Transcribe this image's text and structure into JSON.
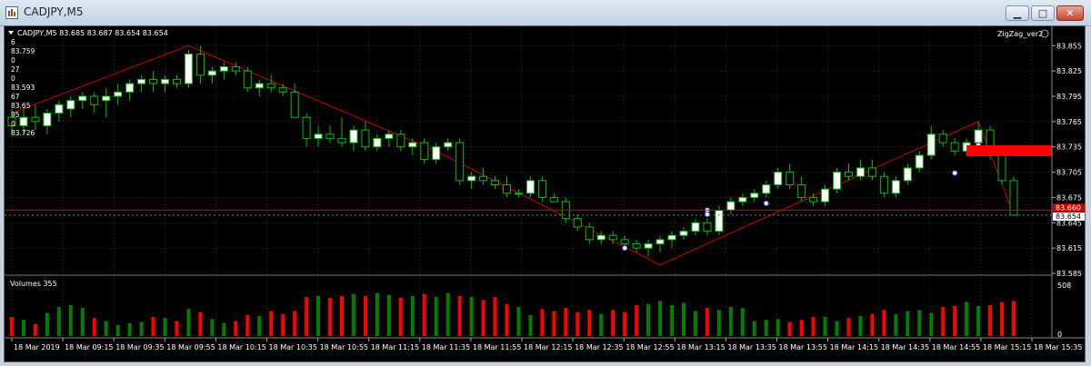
{
  "window": {
    "title": "CADJPY,M5",
    "minimize_glyph": "▁",
    "maximize_glyph": "□",
    "close_glyph": "✕"
  },
  "chart": {
    "header": "CADJPY,M5  83.685 83.687 83.654 83.654",
    "indicator_label": "ZigZag_ver2",
    "indicator_icon": "settings-circle-icon",
    "left_panel_values": [
      "6",
      "83.759",
      "0",
      "27",
      "0",
      "83.593",
      "67",
      "83.65",
      "95",
      "0",
      "83.726"
    ],
    "price_axis": [
      "83.855",
      "83.825",
      "83.795",
      "83.765",
      "83.735",
      "83.705",
      "83.675",
      "83.645",
      "83.615",
      "83.585"
    ],
    "current_price": "83.654",
    "red_line_label": "83.660",
    "volume_label": "Volumes 355",
    "volume_axis": [
      "508",
      "0"
    ],
    "time_axis": [
      "18 Mar 2019",
      "18 Mar 09:15",
      "18 Mar 09:35",
      "18 Mar 09:55",
      "18 Mar 10:15",
      "18 Mar 10:35",
      "18 Mar 10:55",
      "18 Mar 11:15",
      "18 Mar 11:35",
      "18 Mar 11:55",
      "18 Mar 12:15",
      "18 Mar 12:35",
      "18 Mar 12:55",
      "18 Mar 13:15",
      "18 Mar 13:35",
      "18 Mar 13:55",
      "18 Mar 14:15",
      "18 Mar 14:35",
      "18 Mar 14:55",
      "18 Mar 15:15",
      "18 Mar 15:35"
    ],
    "colors": {
      "background": "#000000",
      "grid": "#4a4a4a",
      "bull_body": "#ffffff",
      "bear_body": "#000000",
      "wick": "#00c000",
      "zigzag": "#cc0000",
      "vol_up": "#008000",
      "vol_down": "#ff0000"
    }
  },
  "chart_data": {
    "type": "candlestick",
    "symbol": "CADJPY",
    "timeframe": "M5",
    "ylim": [
      83.585,
      83.865
    ],
    "candles": [
      [
        83.77,
        83.78,
        83.75,
        83.76
      ],
      [
        83.76,
        83.78,
        83.75,
        83.77
      ],
      [
        83.77,
        83.785,
        83.755,
        83.765
      ],
      [
        83.76,
        83.78,
        83.75,
        83.775
      ],
      [
        83.775,
        83.79,
        83.765,
        83.785
      ],
      [
        83.78,
        83.795,
        83.77,
        83.79
      ],
      [
        83.79,
        83.8,
        83.78,
        83.795
      ],
      [
        83.795,
        83.8,
        83.775,
        83.785
      ],
      [
        83.79,
        83.805,
        83.77,
        83.795
      ],
      [
        83.795,
        83.81,
        83.785,
        83.8
      ],
      [
        83.8,
        83.815,
        83.79,
        83.81
      ],
      [
        83.81,
        83.82,
        83.8,
        83.815
      ],
      [
        83.815,
        83.825,
        83.8,
        83.81
      ],
      [
        83.81,
        83.82,
        83.8,
        83.815
      ],
      [
        83.815,
        83.82,
        83.805,
        83.81
      ],
      [
        83.81,
        83.85,
        83.805,
        83.845
      ],
      [
        83.845,
        83.855,
        83.81,
        83.82
      ],
      [
        83.82,
        83.83,
        83.81,
        83.825
      ],
      [
        83.825,
        83.835,
        83.815,
        83.83
      ],
      [
        83.83,
        83.835,
        83.82,
        83.825
      ],
      [
        83.825,
        83.83,
        83.8,
        83.805
      ],
      [
        83.805,
        83.815,
        83.795,
        83.81
      ],
      [
        83.81,
        83.82,
        83.8,
        83.805
      ],
      [
        83.805,
        83.81,
        83.795,
        83.8
      ],
      [
        83.8,
        83.81,
        83.79,
        83.77
      ],
      [
        83.77,
        83.775,
        83.735,
        83.745
      ],
      [
        83.745,
        83.76,
        83.735,
        83.75
      ],
      [
        83.75,
        83.76,
        83.74,
        83.745
      ],
      [
        83.745,
        83.77,
        83.735,
        83.74
      ],
      [
        83.74,
        83.76,
        83.73,
        83.755
      ],
      [
        83.755,
        83.765,
        83.73,
        83.735
      ],
      [
        83.735,
        83.75,
        83.73,
        83.745
      ],
      [
        83.745,
        83.755,
        83.735,
        83.75
      ],
      [
        83.75,
        83.755,
        83.73,
        83.735
      ],
      [
        83.735,
        83.745,
        83.725,
        83.74
      ],
      [
        83.74,
        83.745,
        83.715,
        83.72
      ],
      [
        83.72,
        83.74,
        83.715,
        83.735
      ],
      [
        83.735,
        83.745,
        83.73,
        83.74
      ],
      [
        83.74,
        83.745,
        83.69,
        83.695
      ],
      [
        83.695,
        83.705,
        83.685,
        83.7
      ],
      [
        83.7,
        83.71,
        83.69,
        83.695
      ],
      [
        83.695,
        83.7,
        83.685,
        83.69
      ],
      [
        83.69,
        83.7,
        83.675,
        83.68
      ],
      [
        83.68,
        83.685,
        83.675,
        83.68
      ],
      [
        83.68,
        83.7,
        83.675,
        83.695
      ],
      [
        83.695,
        83.7,
        83.67,
        83.675
      ],
      [
        83.675,
        83.68,
        83.67,
        83.67
      ],
      [
        83.67,
        83.675,
        83.645,
        83.65
      ],
      [
        83.65,
        83.655,
        83.635,
        83.64
      ],
      [
        83.64,
        83.645,
        83.62,
        83.625
      ],
      [
        83.625,
        83.635,
        83.62,
        83.63
      ],
      [
        83.63,
        83.635,
        83.62,
        83.625
      ],
      [
        83.625,
        83.63,
        83.615,
        83.62
      ],
      [
        83.62,
        83.625,
        83.61,
        83.615
      ],
      [
        83.615,
        83.625,
        83.605,
        83.62
      ],
      [
        83.62,
        83.63,
        83.61,
        83.625
      ],
      [
        83.625,
        83.635,
        83.615,
        83.63
      ],
      [
        83.63,
        83.64,
        83.625,
        83.635
      ],
      [
        83.635,
        83.65,
        83.63,
        83.645
      ],
      [
        83.645,
        83.65,
        83.63,
        83.635
      ],
      [
        83.635,
        83.665,
        83.63,
        83.66
      ],
      [
        83.66,
        83.675,
        83.655,
        83.67
      ],
      [
        83.67,
        83.68,
        83.665,
        83.675
      ],
      [
        83.675,
        83.685,
        83.67,
        83.68
      ],
      [
        83.68,
        83.695,
        83.675,
        83.69
      ],
      [
        83.69,
        83.71,
        83.685,
        83.705
      ],
      [
        83.705,
        83.715,
        83.685,
        83.69
      ],
      [
        83.69,
        83.7,
        83.67,
        83.675
      ],
      [
        83.675,
        83.68,
        83.665,
        83.67
      ],
      [
        83.67,
        83.69,
        83.665,
        83.685
      ],
      [
        83.685,
        83.71,
        83.68,
        83.705
      ],
      [
        83.705,
        83.715,
        83.695,
        83.7
      ],
      [
        83.7,
        83.72,
        83.695,
        83.71
      ],
      [
        83.71,
        83.72,
        83.695,
        83.7
      ],
      [
        83.7,
        83.705,
        83.675,
        83.68
      ],
      [
        83.68,
        83.7,
        83.675,
        83.695
      ],
      [
        83.695,
        83.715,
        83.69,
        83.71
      ],
      [
        83.71,
        83.73,
        83.705,
        83.725
      ],
      [
        83.725,
        83.76,
        83.72,
        83.75
      ],
      [
        83.75,
        83.755,
        83.735,
        83.74
      ],
      [
        83.74,
        83.745,
        83.725,
        83.73
      ],
      [
        83.73,
        83.745,
        83.725,
        83.74
      ],
      [
        83.74,
        83.765,
        83.735,
        83.755
      ],
      [
        83.755,
        83.76,
        83.72,
        83.725
      ],
      [
        83.725,
        83.73,
        83.69,
        83.695
      ],
      [
        83.695,
        83.7,
        83.654,
        83.654
      ]
    ],
    "volumes": [
      190,
      160,
      120,
      230,
      290,
      310,
      280,
      180,
      150,
      110,
      130,
      140,
      190,
      180,
      150,
      270,
      240,
      170,
      130,
      150,
      210,
      200,
      250,
      220,
      250,
      390,
      400,
      380,
      400,
      420,
      400,
      430,
      410,
      380,
      400,
      420,
      390,
      430,
      400,
      390,
      360,
      390,
      320,
      290,
      210,
      270,
      250,
      280,
      240,
      260,
      220,
      260,
      240,
      310,
      320,
      350,
      310,
      330,
      250,
      280,
      260,
      290,
      280,
      150,
      160,
      170,
      140,
      160,
      190,
      190,
      150,
      180,
      200,
      220,
      260,
      220,
      250,
      260,
      230,
      290,
      300,
      340,
      300,
      310,
      340,
      350
    ],
    "zigzag": [
      [
        0,
        83.775
      ],
      [
        15,
        83.855
      ],
      [
        36,
        83.73
      ],
      [
        55,
        83.595
      ],
      [
        82,
        83.765
      ],
      [
        85,
        83.654
      ]
    ],
    "horizontal_line": 83.66
  }
}
